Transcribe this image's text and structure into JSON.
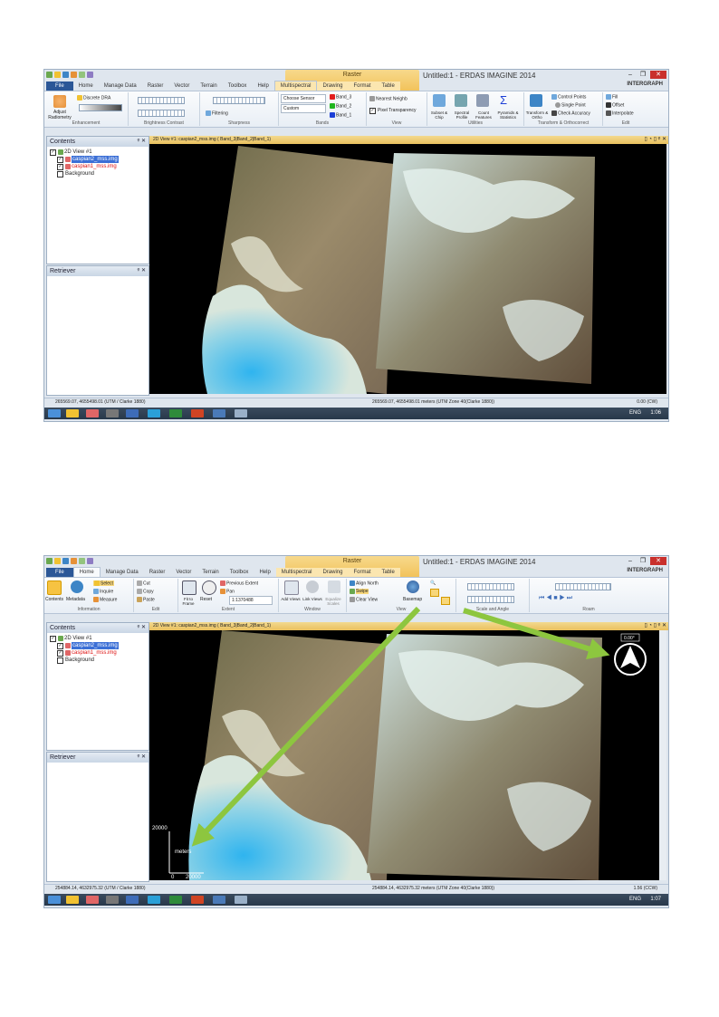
{
  "shots": [
    {
      "app_title": "Untitled:1 - ERDAS IMAGINE 2014",
      "context_tab": "Raster",
      "brand": "INTERGRAPH",
      "tabs": [
        "File",
        "Home",
        "Manage Data",
        "Raster",
        "Vector",
        "Terrain",
        "Toolbox",
        "Help",
        "Multispectral",
        "Drawing",
        "Format",
        "Table"
      ],
      "active_tab": "Multispectral",
      "ribbon": {
        "enhancement": {
          "name": "Enhancement",
          "adjust": "Adjust Radiometry",
          "dra": "Discrete DRA"
        },
        "brightness": {
          "name": "Brightness Contrast"
        },
        "sharpness": {
          "name": "Sharpness",
          "filtering": "Filtering"
        },
        "bands": {
          "name": "Bands",
          "sensor": "Choose Sensor",
          "custom": "Custom",
          "band3": "Band_3",
          "band2": "Band_2",
          "band1": "Band_1"
        },
        "view": {
          "name": "View",
          "nearest": "Nearest Neighb",
          "transparency": "Pixel Transparency"
        },
        "utilities": {
          "name": "Utilities",
          "subset": "Subset & Chip",
          "spectral": "Spectral Profile",
          "count": "Count Features",
          "pyramids": "Pyramids & Statistics"
        },
        "transform": {
          "name": "Transform & Orthocorrect",
          "transform": "Transform & Ortho",
          "control": "Control Points",
          "single": "Single Point",
          "check": "Check Accuracy"
        },
        "edit": {
          "name": "Edit",
          "fill": "Fill",
          "offset": "Offset",
          "interpolate": "Interpolate"
        }
      },
      "contents_title": "Contents",
      "retriever_title": "Retriever",
      "tree": {
        "view": "2D View #1",
        "layer1": "caspian2_mss.img",
        "layer2": "caspian1_mss.img",
        "background": "Background"
      },
      "view_title": "2D View #1: caspian2_mss.img ( Band_3|Band_2|Band_1)",
      "status_left": "265569.07, 4655498.01  (UTM / Clarke 1880)",
      "status_mid": "265569.07, 4655498.01 meters (UTM Zone 40(Clarke 1880))",
      "status_right": "0.00 (CW)",
      "taskbar_lang": "ENG",
      "taskbar_time": "1:06"
    },
    {
      "app_title": "Untitled:1 - ERDAS IMAGINE 2014",
      "context_tab": "Raster",
      "brand": "INTERGRAPH",
      "tabs": [
        "File",
        "Home",
        "Manage Data",
        "Raster",
        "Vector",
        "Terrain",
        "Toolbox",
        "Help",
        "Multispectral",
        "Drawing",
        "Format",
        "Table"
      ],
      "active_tab": "Home",
      "ribbon": {
        "information": {
          "name": "Information",
          "contents": "Contents",
          "metadata": "Metadata",
          "select": "Select",
          "inquire": "Inquire",
          "measure": "Measure"
        },
        "edit": {
          "name": "Edit",
          "cut": "Cut",
          "copy": "Copy",
          "paste": "Paste"
        },
        "extent": {
          "name": "Extent",
          "fit": "Fit to Frame",
          "reset": "Reset",
          "prev": "Previous Extent",
          "pan": "Pan",
          "scale": "1:1370488"
        },
        "window": {
          "name": "Window",
          "add": "Add Views",
          "link": "Link Views",
          "equalize": "Equalize Scales"
        },
        "view": {
          "name": "View",
          "align": "Align North",
          "swipe": "Swipe",
          "clear": "Clear View",
          "basemap": "Basemap"
        },
        "scale_angle": {
          "name": "Scale and Angle"
        },
        "roam": {
          "name": "Roam"
        }
      },
      "contents_title": "Contents",
      "retriever_title": "Retriever",
      "tree": {
        "view": "2D View #1",
        "layer1": "caspian2_mss.img",
        "layer2": "caspian1_mss.img",
        "background": "Background"
      },
      "view_title": "2D View #1: caspian2_mss.img ( Band_3|Band_2|Band_1)",
      "status_left": "254884.14, 4632975.32  (UTM / Clarke 1880)",
      "status_mid": "254884.14, 4632975.32 meters (UTM Zone 40(Clarke 1880))",
      "status_right": "1.56 (CCW)",
      "taskbar_lang": "ENG",
      "taskbar_time": "1:07",
      "scalebar": {
        "top": "20000",
        "unit": "meters",
        "origin": "0",
        "right": "20000"
      },
      "north_angle": "0.00°"
    }
  ],
  "colors": {
    "arrow": "#8dc63f",
    "file_tab": "#2b5797",
    "view_header": "#f0cf78",
    "context": "#f2c35b"
  }
}
